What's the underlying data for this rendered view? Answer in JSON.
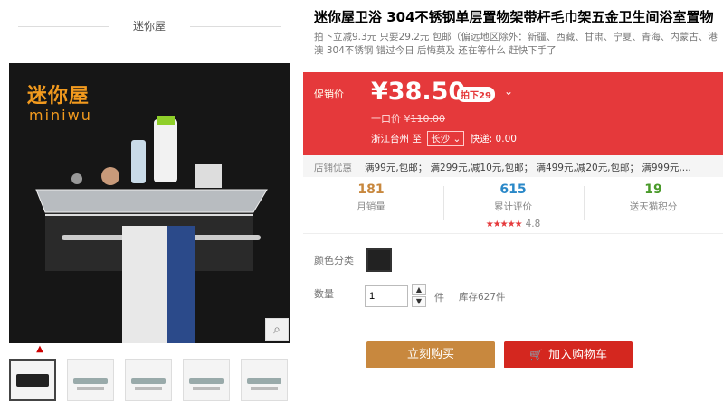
{
  "shop": {
    "title": "迷你屋"
  },
  "product_image": {
    "logo_cn": "迷你屋",
    "logo_en": "miniwu"
  },
  "gallery": {
    "up_arrow": "▲",
    "thumb_count": 5
  },
  "icons": {
    "zoom": "search-icon",
    "cart": "cart-icon",
    "dropdown": "chevron-down-icon"
  },
  "product": {
    "title": "迷你屋卫浴 304不锈钢单层置物架带杆毛巾架五金卫生间浴室置物",
    "subtitle": "拍下立减9.3元 只要29.2元 包邮（偏远地区除外：新疆、西藏、甘肃、宁夏、青海、内蒙古、港澳 304不锈钢 错过今日 后悔莫及 还在等什么 赶快下手了"
  },
  "price": {
    "label": "促销价",
    "current": "¥38.50",
    "badge": "拍下29",
    "original_label": "一口价 ¥",
    "original": "110.00",
    "origin": "浙江台州",
    "to": "至",
    "dest": "长沙",
    "shipping": "快递: 0.00"
  },
  "promo": {
    "label": "店铺优惠",
    "text": "满99元,包邮；  满299元,减10元,包邮；  满499元,减20元,包邮；  满999元,..."
  },
  "stats": {
    "sales": {
      "value": "181",
      "label": "月销量"
    },
    "reviews": {
      "value": "615",
      "label": "累计评价",
      "stars": "★★★★★",
      "score": "4.8"
    },
    "points": {
      "value": "19",
      "label": "送天猫积分"
    }
  },
  "options": {
    "color_label": "颜色分类",
    "qty_label": "数量",
    "qty_value": "1",
    "unit": "件",
    "stock": "库存627件"
  },
  "actions": {
    "buy": "立刻购买",
    "cart": "加入购物车"
  },
  "colors": {
    "price_bg": "#e5393b",
    "buy": "#c8883e",
    "cart": "#d4271f"
  }
}
